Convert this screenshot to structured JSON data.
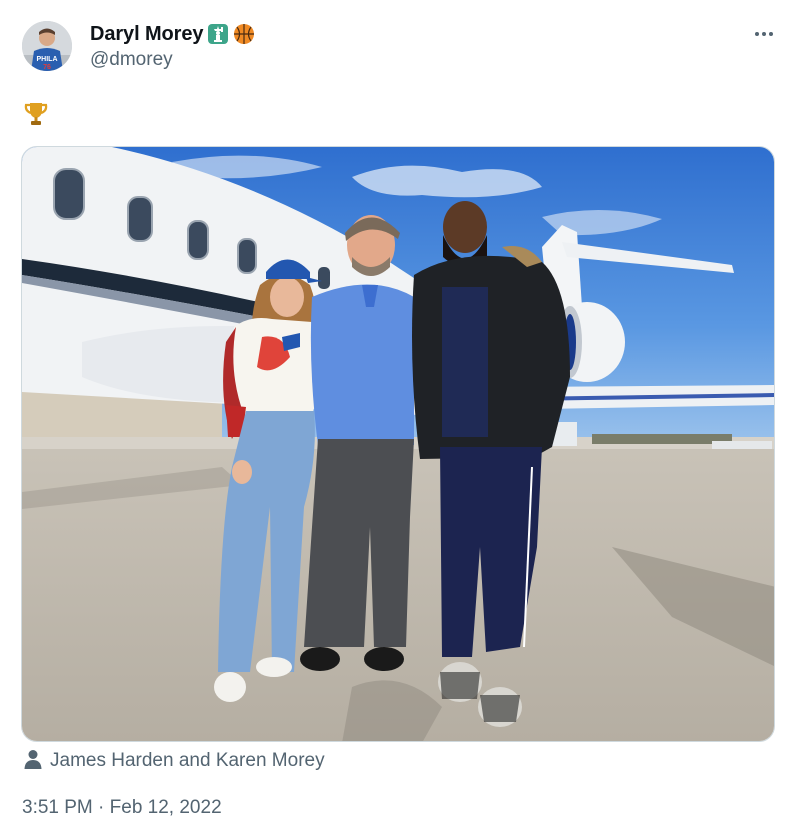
{
  "tweet": {
    "author": {
      "display_name": "Daryl Morey",
      "handle": "@dmorey",
      "badges": [
        "statue-of-liberty-emoji",
        "basketball-emoji"
      ]
    },
    "text_emoji": "trophy-emoji",
    "media": {
      "description_icon": "airplane-photo"
    },
    "tagged_people": "James Harden and Karen Morey",
    "time": "3:51 PM",
    "separator": " · ",
    "date": "Feb 12, 2022"
  },
  "colors": {
    "name": "#0f1419",
    "secondary": "#536471",
    "sky": "#3f86d8",
    "trophy": "#e0a020"
  }
}
